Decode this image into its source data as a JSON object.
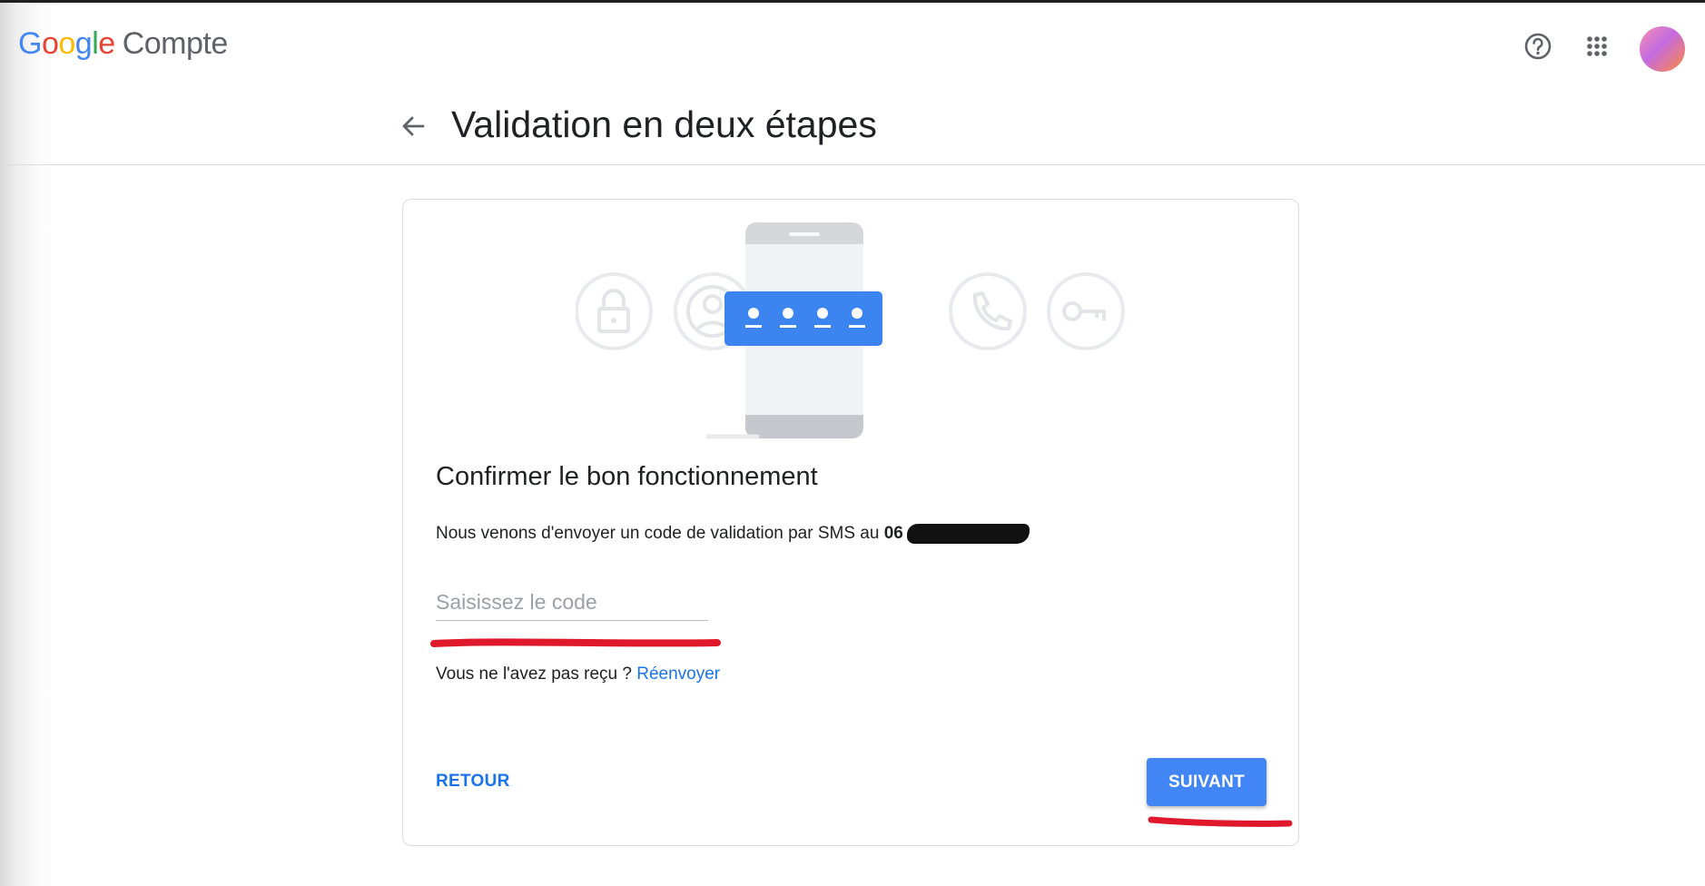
{
  "header": {
    "brand": {
      "g1": "G",
      "o1": "o",
      "o2": "o",
      "g2": "g",
      "l": "l",
      "e": "e",
      "product": "Compte"
    },
    "help_icon": "help-circle-icon",
    "apps_icon": "apps-grid-icon"
  },
  "page": {
    "title": "Validation en deux étapes",
    "back_icon": "arrow-back-icon"
  },
  "card": {
    "illustration_icons": [
      "lock-icon",
      "account-circle-icon",
      "phone-device-icon",
      "code-dots-icon",
      "phone-call-icon",
      "key-icon"
    ],
    "title": "Confirmer le bon fonctionnement",
    "sms_text": "Nous venons d'envoyer un code de validation par SMS au",
    "phone_prefix": "06",
    "code_input": {
      "placeholder": "Saisissez le code",
      "value": ""
    },
    "resend_prompt": "Vous ne l'avez pas reçu ?",
    "resend_link": "Réenvoyer",
    "back_button": "RETOUR",
    "next_button": "SUIVANT"
  },
  "colors": {
    "accent_blue": "#1a73e8",
    "button_blue": "#4285f4",
    "annotation_red": "#e0182b"
  }
}
